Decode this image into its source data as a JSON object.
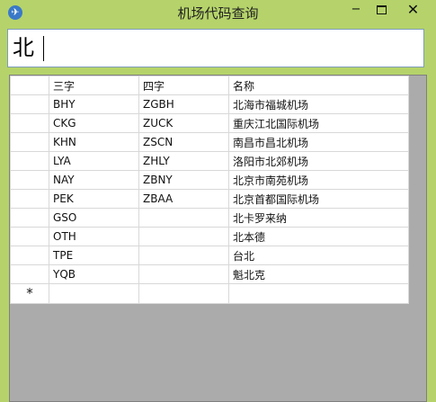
{
  "window": {
    "title": "机场代码查询",
    "icon": "app-icon",
    "minimize_glyph": "−",
    "close_glyph": "✕"
  },
  "search": {
    "value": "北"
  },
  "table": {
    "columns": [
      "三字",
      "四字",
      "名称"
    ],
    "rows": [
      [
        "BHY",
        "ZGBH",
        "北海市福城机场"
      ],
      [
        "CKG",
        "ZUCK",
        "重庆江北国际机场"
      ],
      [
        "KHN",
        "ZSCN",
        "南昌市昌北机场"
      ],
      [
        "LYA",
        "ZHLY",
        "洛阳市北郊机场"
      ],
      [
        "NAY",
        "ZBNY",
        "北京市南苑机场"
      ],
      [
        "PEK",
        "ZBAA",
        "北京首都国际机场"
      ],
      [
        "GSO",
        "",
        "北卡罗来纳"
      ],
      [
        "OTH",
        "",
        "北本德"
      ],
      [
        "TPE",
        "",
        "台北"
      ],
      [
        "YQB",
        "",
        "魁北克"
      ]
    ],
    "new_row_marker": "*"
  }
}
